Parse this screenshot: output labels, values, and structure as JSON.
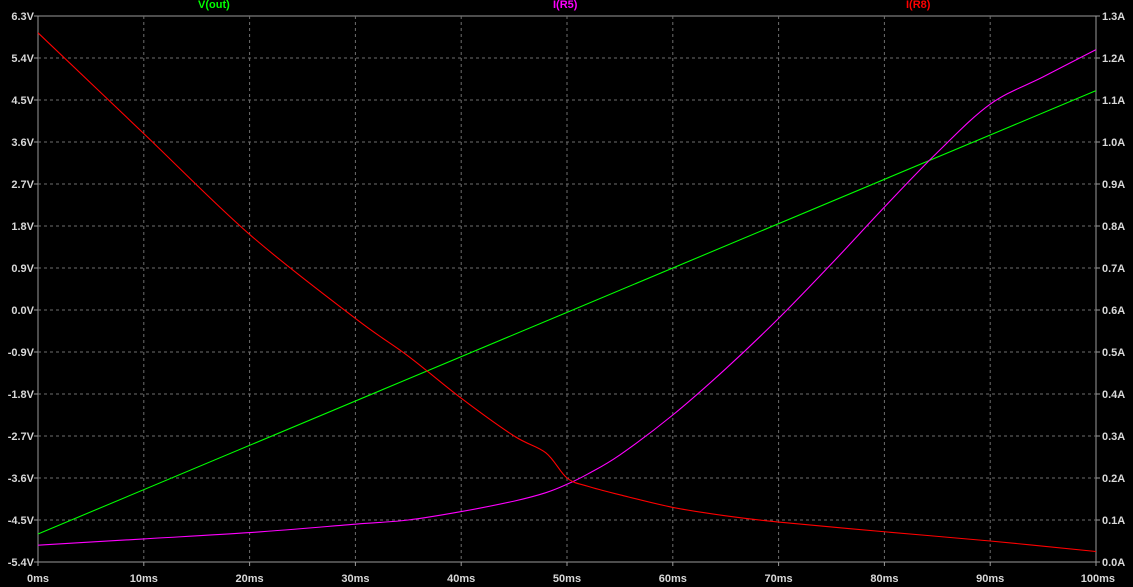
{
  "chart_data": {
    "type": "line",
    "x_ticks": [
      "0ms",
      "10ms",
      "20ms",
      "30ms",
      "40ms",
      "50ms",
      "60ms",
      "70ms",
      "80ms",
      "90ms",
      "100ms"
    ],
    "xlim": [
      0,
      100
    ],
    "left_ticks": [
      "6.3V",
      "5.4V",
      "4.5V",
      "3.6V",
      "2.7V",
      "1.8V",
      "0.9V",
      "0.0V",
      "-0.9V",
      "-1.8V",
      "-2.7V",
      "-3.6V",
      "-4.5V",
      "-5.4V"
    ],
    "left_lim": [
      -5.4,
      6.3
    ],
    "right_ticks": [
      "1.3A",
      "1.2A",
      "1.1A",
      "1.0A",
      "0.9A",
      "0.8A",
      "0.7A",
      "0.6A",
      "0.5A",
      "0.4A",
      "0.3A",
      "0.2A",
      "0.1A",
      "0.0A"
    ],
    "right_lim": [
      0.0,
      1.3
    ],
    "grid": true,
    "series": [
      {
        "name": "V(out)",
        "color": "#00ff00",
        "axis": "left",
        "x": [
          0,
          100
        ],
        "y": [
          -4.8,
          4.7
        ]
      },
      {
        "name": "I(R5)",
        "color": "#ff00ff",
        "axis": "right",
        "x": [
          0,
          10,
          20,
          30,
          35,
          40,
          45,
          48,
          50,
          52,
          55,
          60,
          65,
          70,
          75,
          80,
          85,
          90,
          95,
          100
        ],
        "y": [
          0.04,
          0.055,
          0.07,
          0.09,
          0.1,
          0.12,
          0.145,
          0.165,
          0.185,
          0.21,
          0.255,
          0.35,
          0.46,
          0.58,
          0.71,
          0.845,
          0.975,
          1.09,
          1.155,
          1.22
        ]
      },
      {
        "name": "I(R8)",
        "color": "#ff0000",
        "axis": "right",
        "x": [
          0,
          10,
          20,
          30,
          35,
          40,
          45,
          48,
          50,
          52,
          55,
          60,
          65,
          70,
          80,
          90,
          100
        ],
        "y": [
          1.26,
          1.02,
          0.78,
          0.58,
          0.49,
          0.39,
          0.3,
          0.26,
          0.2,
          0.18,
          0.16,
          0.13,
          0.11,
          0.095,
          0.072,
          0.05,
          0.025
        ]
      }
    ]
  }
}
